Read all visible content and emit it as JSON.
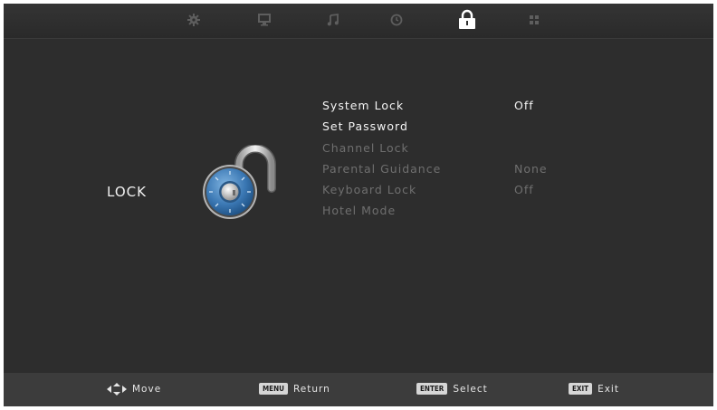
{
  "tabs": [
    {
      "icon": "settings-gear-icon",
      "active": false
    },
    {
      "icon": "monitor-icon",
      "active": false
    },
    {
      "icon": "music-note-icon",
      "active": false
    },
    {
      "icon": "clock-icon",
      "active": false
    },
    {
      "icon": "lock-icon",
      "active": true
    },
    {
      "icon": "apps-grid-icon",
      "active": false
    }
  ],
  "section": {
    "title": "LOCK",
    "illustration": "padlock-icon"
  },
  "menu": {
    "items": [
      {
        "label": "System Lock",
        "value": "Off",
        "enabled": true
      },
      {
        "label": "Set Password",
        "value": "",
        "enabled": true
      },
      {
        "label": "Channel Lock",
        "value": "",
        "enabled": false
      },
      {
        "label": "Parental Guidance",
        "value": "None",
        "enabled": false
      },
      {
        "label": "Keyboard Lock",
        "value": "Off",
        "enabled": false
      },
      {
        "label": "Hotel Mode",
        "value": "",
        "enabled": false
      }
    ]
  },
  "hints": [
    {
      "key": "",
      "icon": "dpad-arrows-icon",
      "label": "Move"
    },
    {
      "key": "MENU",
      "label": "Return"
    },
    {
      "key": "ENTER",
      "label": "Select"
    },
    {
      "key": "EXIT",
      "label": "Exit"
    }
  ],
  "colors": {
    "background": "#2d2d2d",
    "active_text": "#f4f4f4",
    "disabled_text": "#6f6f6f",
    "dial_blue": "#3b78b4"
  }
}
